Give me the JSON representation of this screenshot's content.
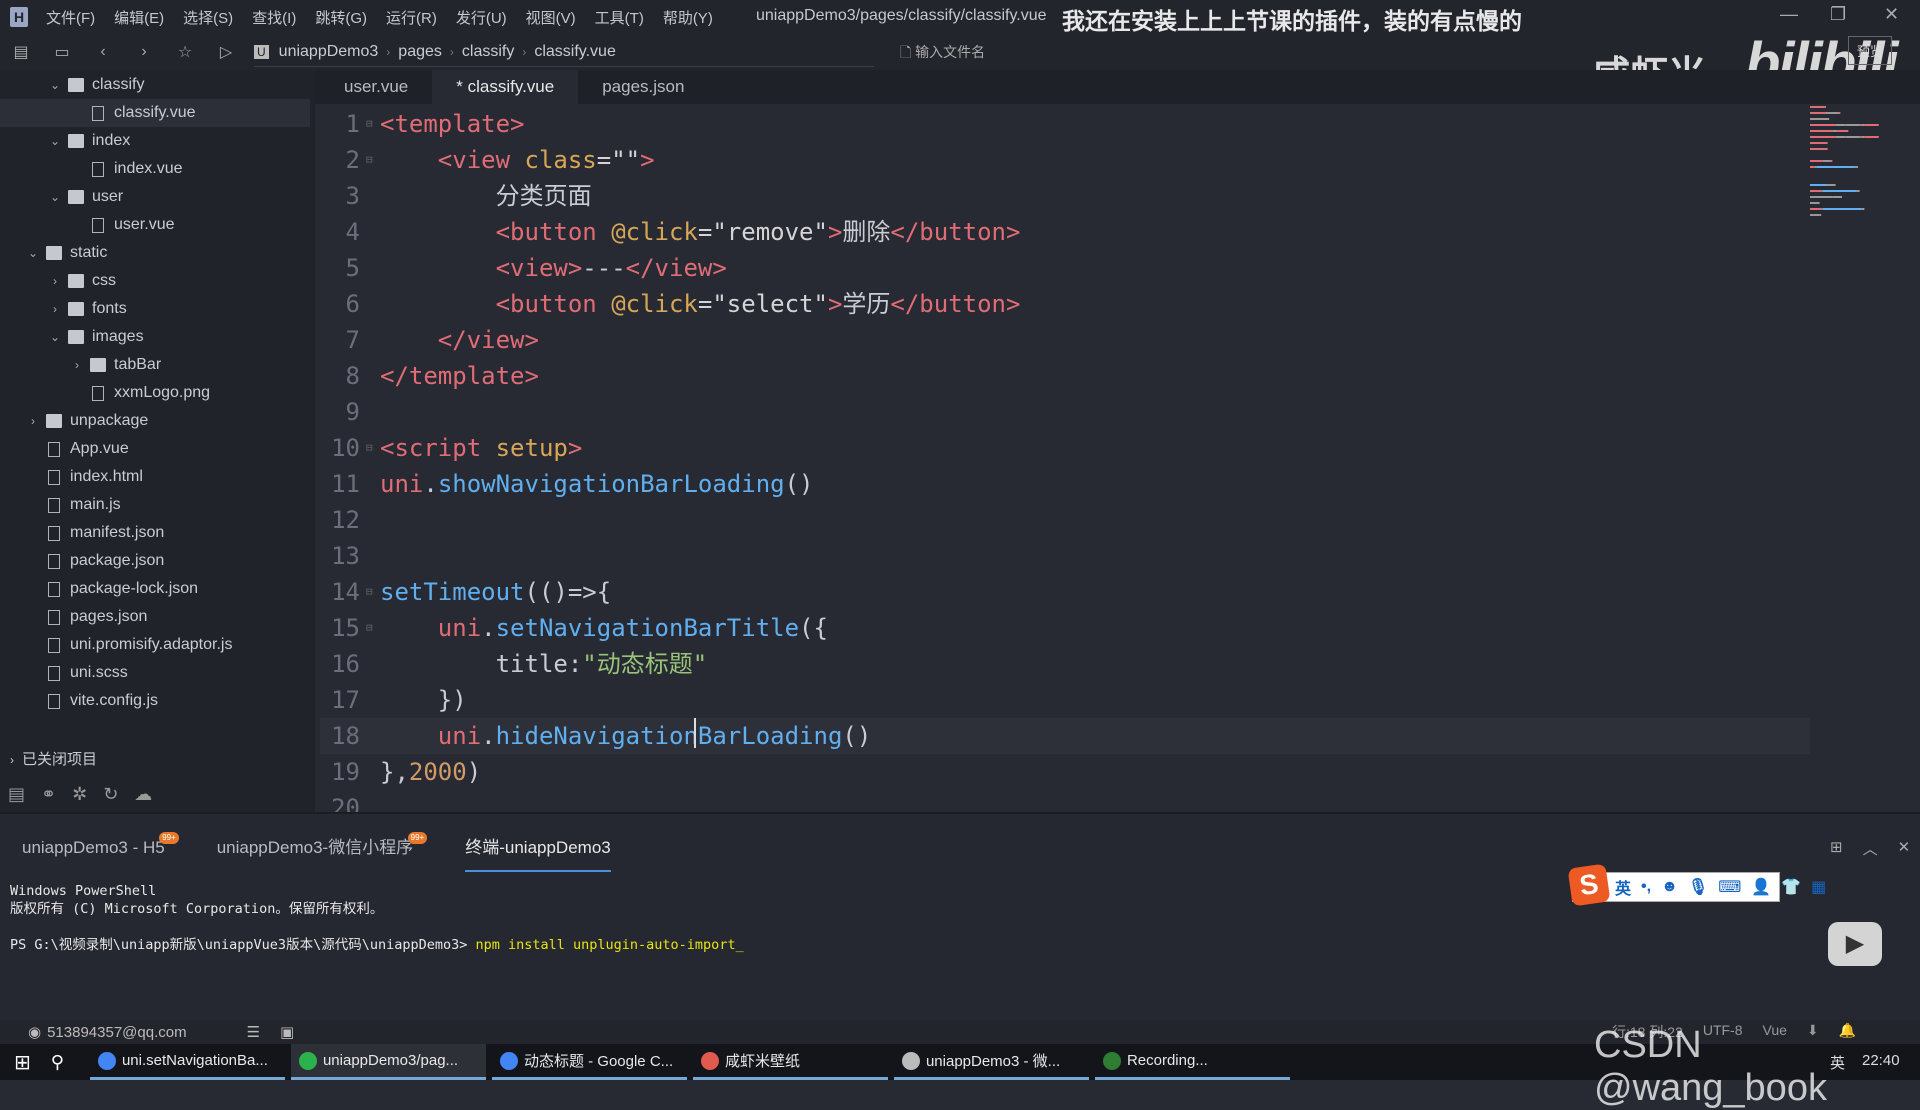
{
  "menu": {
    "items": [
      "文件(F)",
      "编辑(E)",
      "选择(S)",
      "查找(I)",
      "跳转(G)",
      "运行(R)",
      "发行(U)",
      "视图(V)",
      "工具(T)",
      "帮助(Y)"
    ]
  },
  "window": {
    "title": "uniappDemo3/pages/classify/classify.vue",
    "subtitle": "我还在安装上上上节课的插件，装的有点慢的"
  },
  "breadcrumb": [
    "uniappDemo3",
    "pages",
    "classify",
    "classify.vue"
  ],
  "file_search": {
    "placeholder": "输入文件名"
  },
  "preview_label": "预览",
  "watermark": {
    "author": "咸虾米_",
    "logo": "bilibili",
    "csdn": "CSDN @wang_book"
  },
  "sidebar": {
    "items": [
      {
        "label": "classify",
        "type": "folder",
        "depth": 1,
        "open": true
      },
      {
        "label": "classify.vue",
        "type": "file",
        "depth": 2,
        "selected": true
      },
      {
        "label": "index",
        "type": "folder",
        "depth": 1,
        "open": true
      },
      {
        "label": "index.vue",
        "type": "file",
        "depth": 2
      },
      {
        "label": "user",
        "type": "folder",
        "depth": 1,
        "open": true
      },
      {
        "label": "user.vue",
        "type": "file",
        "depth": 2
      },
      {
        "label": "static",
        "type": "folder",
        "depth": 0,
        "open": true
      },
      {
        "label": "css",
        "type": "folder",
        "depth": 1,
        "open": false
      },
      {
        "label": "fonts",
        "type": "folder",
        "depth": 1,
        "open": false
      },
      {
        "label": "images",
        "type": "folder",
        "depth": 1,
        "open": true
      },
      {
        "label": "tabBar",
        "type": "folder",
        "depth": 2,
        "open": false
      },
      {
        "label": "xxmLogo.png",
        "type": "file",
        "depth": 2
      },
      {
        "label": "unpackage",
        "type": "folder",
        "depth": 0,
        "open": false
      },
      {
        "label": "App.vue",
        "type": "file",
        "depth": 0
      },
      {
        "label": "index.html",
        "type": "file",
        "depth": 0
      },
      {
        "label": "main.js",
        "type": "file",
        "depth": 0
      },
      {
        "label": "manifest.json",
        "type": "file",
        "depth": 0
      },
      {
        "label": "package.json",
        "type": "file",
        "depth": 0
      },
      {
        "label": "package-lock.json",
        "type": "file",
        "depth": 0
      },
      {
        "label": "pages.json",
        "type": "file",
        "depth": 0
      },
      {
        "label": "uni.promisify.adaptor.js",
        "type": "file",
        "depth": 0
      },
      {
        "label": "uni.scss",
        "type": "file",
        "depth": 0
      },
      {
        "label": "vite.config.js",
        "type": "file",
        "depth": 0
      }
    ],
    "closed_projects": "已关闭项目"
  },
  "tabs": [
    {
      "label": "user.vue"
    },
    {
      "label": "* classify.vue",
      "active": true
    },
    {
      "label": "pages.json"
    }
  ],
  "code": [
    [
      [
        "<",
        "tag"
      ],
      [
        "template",
        "tag"
      ],
      [
        ">",
        "tag"
      ]
    ],
    [
      [
        "    <view ",
        "tag"
      ],
      [
        "class",
        "attr"
      ],
      [
        "=\"\"",
        "str"
      ],
      [
        ">",
        "tag"
      ]
    ],
    [
      [
        "        分类页面",
        "txt"
      ]
    ],
    [
      [
        "        <button ",
        "tag"
      ],
      [
        "@click",
        "attr"
      ],
      [
        "=\"remove\"",
        "str"
      ],
      [
        ">",
        "tag"
      ],
      [
        "删除",
        "txt"
      ],
      [
        "</button>",
        "tag"
      ]
    ],
    [
      [
        "        <view>",
        "tag"
      ],
      [
        "---",
        "txt"
      ],
      [
        "</view>",
        "tag"
      ]
    ],
    [
      [
        "        <button ",
        "tag"
      ],
      [
        "@click",
        "attr"
      ],
      [
        "=\"select\"",
        "str"
      ],
      [
        ">",
        "tag"
      ],
      [
        "学历",
        "txt"
      ],
      [
        "</button>",
        "tag"
      ]
    ],
    [
      [
        "    </view>",
        "tag"
      ]
    ],
    [
      [
        "</template>",
        "tag"
      ]
    ],
    [],
    [
      [
        "<script ",
        "tag"
      ],
      [
        "setup",
        "attr"
      ],
      [
        ">",
        "tag"
      ]
    ],
    [
      [
        "uni",
        "obj"
      ],
      [
        ".",
        "pun"
      ],
      [
        "showNavigationBarLoading",
        "fn"
      ],
      [
        "()",
        "pun"
      ]
    ],
    [],
    [],
    [
      [
        "setTimeout",
        "fn"
      ],
      [
        "(()=>{",
        "pun"
      ]
    ],
    [
      [
        "    uni",
        "obj"
      ],
      [
        ".",
        "pun"
      ],
      [
        "setNavigationBarTitle",
        "fn"
      ],
      [
        "({",
        "pun"
      ]
    ],
    [
      [
        "        title:",
        "txt"
      ],
      [
        "\"动态标题\"",
        "grn"
      ]
    ],
    [
      [
        "    })",
        "pun"
      ]
    ],
    [
      [
        "    uni",
        "obj"
      ],
      [
        ".",
        "pun"
      ],
      [
        "hideNavigationBarLoading",
        "fn"
      ],
      [
        "()",
        "pun"
      ]
    ],
    [
      [
        "},",
        "pun"
      ],
      [
        "2000",
        "num"
      ],
      [
        ")",
        "pun"
      ]
    ],
    []
  ],
  "editor": {
    "current_line": 18
  },
  "panel": {
    "tabs": [
      {
        "label": "uniappDemo3 - H5",
        "badge": "99+"
      },
      {
        "label": "uniappDemo3-微信小程序",
        "badge": "99+"
      },
      {
        "label": "终端-uniappDemo3",
        "active": true
      }
    ],
    "terminal": {
      "line1": "Windows PowerShell",
      "line2": "版权所有 (C) Microsoft Corporation。保留所有权利。",
      "prompt": "PS G:\\视频录制\\uniapp新版\\uniappVue3版本\\源代码\\uniappDemo3> ",
      "command": "npm install unplugin-auto-import_"
    }
  },
  "ime": {
    "lang": "英"
  },
  "status": {
    "user": "513894357@qq.com",
    "position": "行:18  列:22",
    "encoding": "UTF-8",
    "language": "Vue"
  },
  "taskbar": {
    "items": [
      {
        "label": "uni.setNavigationBa...",
        "color": "#4285f4"
      },
      {
        "label": "uniappDemo3/pag...",
        "color": "#2bb24c",
        "active": true
      },
      {
        "label": "动态标题 - Google C...",
        "color": "#4285f4"
      },
      {
        "label": "咸虾米壁纸",
        "color": "#e05a4f"
      },
      {
        "label": "uniappDemo3 - 微...",
        "color": "#bbbbbb"
      },
      {
        "label": "Recording...",
        "color": "#2e7d32"
      }
    ],
    "clock": "22:40",
    "ime_lang": "英"
  }
}
